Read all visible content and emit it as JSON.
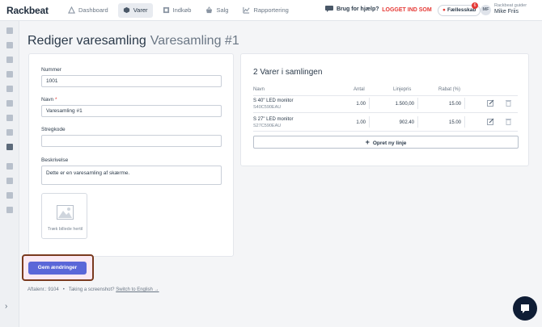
{
  "app": {
    "logo": "Rackbeat"
  },
  "nav": [
    {
      "label": "Dashboard",
      "icon": "dashboard-icon",
      "active": false
    },
    {
      "label": "Varer",
      "icon": "cube-icon",
      "active": true
    },
    {
      "label": "Indkøb",
      "icon": "purchase-icon",
      "active": false
    },
    {
      "label": "Salg",
      "icon": "basket-icon",
      "active": false
    },
    {
      "label": "Rapportering",
      "icon": "report-icon",
      "active": false
    }
  ],
  "header": {
    "help": "Brug for hjælp?",
    "logged_in": "LOGGET IND SOM",
    "shared": "Fællesskab",
    "badge": "6",
    "avatar": "MF",
    "org": "Rackbeat guider",
    "user": "Mike Friis"
  },
  "page": {
    "title": "Rediger varesamling",
    "subtitle": "Varesamling #1"
  },
  "form": {
    "number_label": "Nummer",
    "number_value": "1001",
    "name_label": "Navn",
    "name_req": "*",
    "name_value": "Varesamling #1",
    "barcode_label": "Stregkode",
    "barcode_value": "",
    "desc_label": "Beskrivelse",
    "desc_value": "Dette er en varesamling af skærme.",
    "image_caption": "Træk billede hertil",
    "save": "Gem ændringer"
  },
  "footer": {
    "account": "Aftalenr.: 9104",
    "sep": "•",
    "screenshot": "Taking a screenshot?",
    "english": "Switch to English →"
  },
  "collection": {
    "title": "2 Varer i samlingen",
    "headers": {
      "name": "Navn",
      "qty": "Antal",
      "price": "Linjepris",
      "discount": "Rabat (%)"
    },
    "rows": [
      {
        "name": "S 40\" LED monitor",
        "sku": "S40C590EAU",
        "qty": "1.00",
        "price": "1.500,00",
        "discount": "15.00"
      },
      {
        "name": "S 27\" LED monitor",
        "sku": "S27C590EAU",
        "qty": "1.00",
        "price": "902.40",
        "discount": "15.00"
      }
    ],
    "add_line": "Opret ny linje"
  },
  "colors": {
    "primary": "#5a67d8",
    "danger": "#e53935",
    "highlight": "#7a3a1f",
    "chat": "#0f1d35"
  }
}
